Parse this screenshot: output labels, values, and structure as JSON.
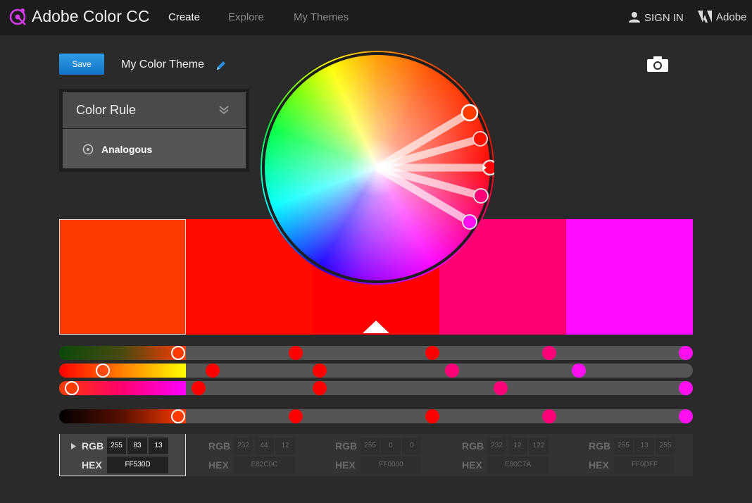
{
  "app": {
    "brand": "Adobe Color CC"
  },
  "nav": {
    "create": "Create",
    "explore": "Explore",
    "my_themes": "My Themes"
  },
  "account": {
    "sign_in": "SIGN IN",
    "adobe": "Adobe"
  },
  "toolbar": {
    "save_label": "Save",
    "theme_name": "My Color Theme"
  },
  "color_rule": {
    "title": "Color Rule",
    "selected": "Analogous"
  },
  "colors": {
    "accent": "#1a86d8",
    "swatches": [
      "#FF530D",
      "#E82C0C",
      "#FF0000",
      "#E80C7A",
      "#FF0DFF"
    ]
  },
  "swatches": [
    {
      "rgb": [
        "255",
        "83",
        "13"
      ],
      "hex": "FF530D"
    },
    {
      "rgb": [
        "232",
        "44",
        "12"
      ],
      "hex": "E82C0C"
    },
    {
      "rgb": [
        "255",
        "0",
        "0"
      ],
      "hex": "FF0000"
    },
    {
      "rgb": [
        "232",
        "12",
        "122"
      ],
      "hex": "E80C7A"
    },
    {
      "rgb": [
        "255",
        "13",
        "255"
      ],
      "hex": "FF0DFF"
    }
  ],
  "labels": {
    "rgb": "RGB",
    "hex": "HEX"
  }
}
